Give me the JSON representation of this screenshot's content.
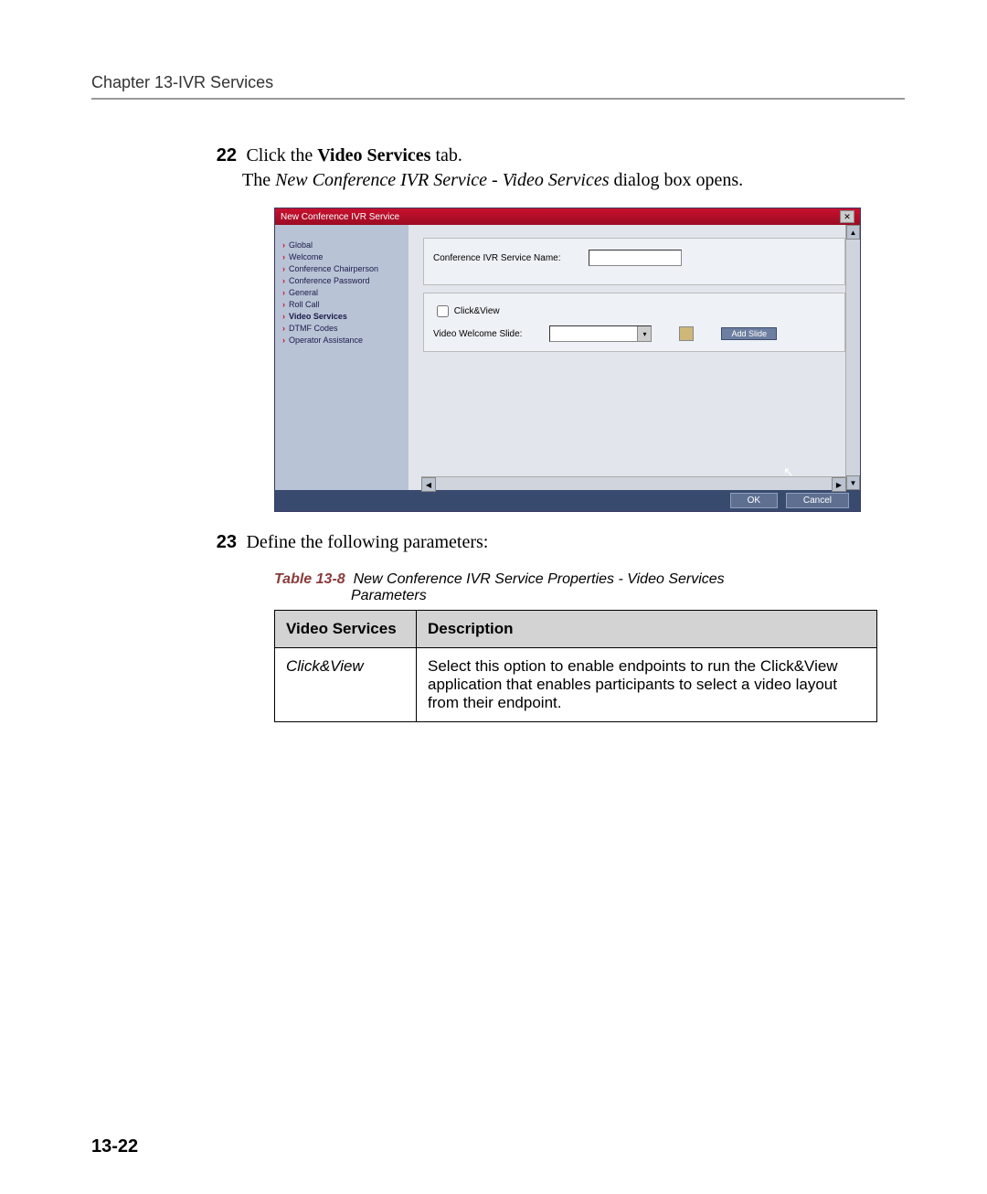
{
  "header": {
    "chapter": "Chapter 13-IVR Services"
  },
  "steps": {
    "s22": {
      "num": "22",
      "prefix": "Click the ",
      "bold": "Video Services",
      "suffix": " tab.",
      "line2a": "The ",
      "line2_italic": "New Conference IVR Service - Video Services",
      "line2b": " dialog box opens."
    },
    "s23": {
      "num": "23",
      "text": "Define the following parameters:"
    }
  },
  "dialog": {
    "title": "New Conference IVR Service",
    "sidebar": [
      "Global",
      "Welcome",
      "Conference Chairperson",
      "Conference Password",
      "General",
      "Roll Call",
      "Video Services",
      "DTMF Codes",
      "Operator Assistance"
    ],
    "field_name_label": "Conference IVR Service Name:",
    "check_label": "Click&View",
    "slide_label": "Video Welcome Slide:",
    "add_btn": "Add Slide",
    "ok": "OK",
    "cancel": "Cancel"
  },
  "table": {
    "caption_label": "Table 13-8",
    "caption_text1": "New Conference IVR Service Properties - Video Services",
    "caption_text2": "Parameters",
    "head1": "Video Services",
    "head2": "Description",
    "row1_col1": "Click&View",
    "row1_col2": "Select this option to enable endpoints to run the Click&View application that enables participants to select a video layout from their endpoint."
  },
  "page_number": "13-22"
}
